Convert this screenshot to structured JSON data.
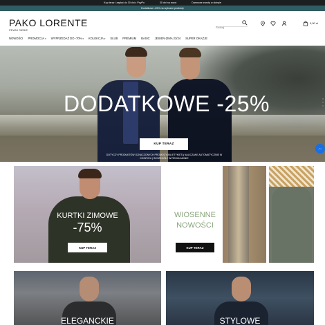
{
  "promo_bar": {
    "items": [
      "Kup teraz i zapłać do 30 dni z PayPo",
      "30 dni na zwrot",
      "Darmowe zwroty w sklepie"
    ],
    "sub_text": "Dodatkowe -25% na wybrane produkty"
  },
  "header": {
    "logo": "PAKO LORENTE",
    "tagline": "PEWNI SIEBIE",
    "search_placeholder": "Szukaj",
    "icons": [
      "search-icon",
      "location-pin-icon",
      "heart-icon",
      "user-icon",
      "bag-icon"
    ],
    "cart_amount": "0,00 zł"
  },
  "nav": {
    "items": [
      {
        "label": "NOWOŚCI",
        "dropdown": false,
        "red": false
      },
      {
        "label": "PROMOCJA",
        "dropdown": true,
        "red": false
      },
      {
        "label": "WYPRZEDAŻ DO -70%",
        "dropdown": true,
        "red": true
      },
      {
        "label": "KOLEKCJA",
        "dropdown": true,
        "red": false
      },
      {
        "label": "SLUB",
        "dropdown": false,
        "red": false
      },
      {
        "label": "PREMIUM",
        "dropdown": false,
        "red": false
      },
      {
        "label": "BASIC",
        "dropdown": false,
        "red": false
      },
      {
        "label": "JESIEŃ-ZIMA 23/24",
        "dropdown": false,
        "red": false
      },
      {
        "label": "SUPER OKAZJE",
        "dropdown": false,
        "red": true
      }
    ]
  },
  "hero": {
    "title": "DODATKOWE -25%",
    "button": "KUP TERAZ",
    "note": "DOTYCZY PRODUKTÓW OZNACZONYCH PROMOCYJNA ETYKIETĄ NALICZANE AUTOMATYCZNIE W KOSZYKU | SZCZEGÓŁY W REGULAMINIE"
  },
  "tiles": {
    "jackets": {
      "title_line1": "KURTKI ZIMOWE",
      "title_line2": "-75%",
      "button": "KUP TERAZ"
    },
    "spring": {
      "title_line1": "WIOSENNE",
      "title_line2": "NOWOŚCI",
      "button": "KUP TERAZ"
    },
    "elegant": {
      "title": "ELEGANCKIE"
    },
    "stylish": {
      "title": "STYLOWE"
    }
  },
  "colors": {
    "promo_bar": "#1c1f20",
    "sub_bar": "#2f5d63",
    "accent_red": "#d11b1b",
    "messenger": "#1a6fe0",
    "spring_text": "#8aa57d"
  }
}
